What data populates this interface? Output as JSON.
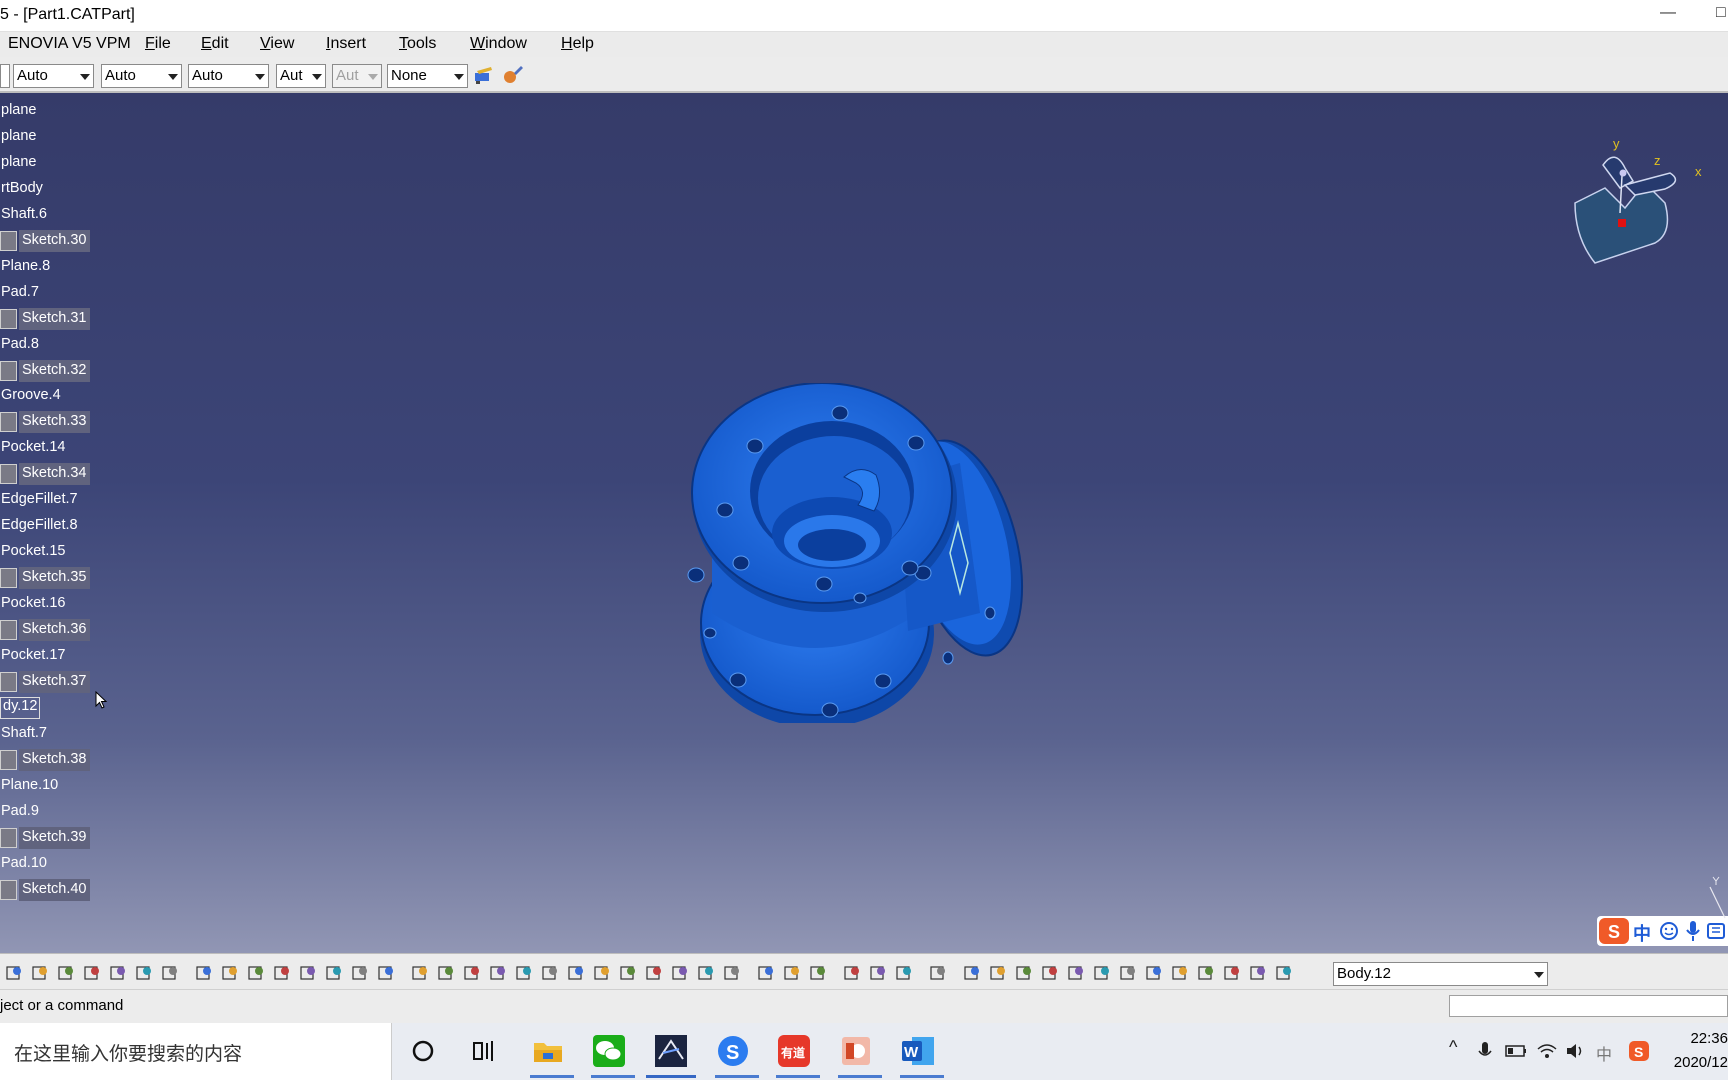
{
  "window": {
    "title": "5 - [Part1.CATPart]",
    "minimize_glyph": "—",
    "restore_glyph": "□"
  },
  "menu": [
    {
      "label": "ENOVIA V5 VPM"
    },
    {
      "label": "File",
      "key": "F",
      "rest": "ile"
    },
    {
      "label": "Edit",
      "key": "E",
      "rest": "dit"
    },
    {
      "label": "View",
      "key": "V",
      "rest": "iew"
    },
    {
      "label": "Insert",
      "key": "I",
      "rest": "nsert"
    },
    {
      "label": "Tools",
      "key": "T",
      "rest": "ools"
    },
    {
      "label": "Window",
      "key": "W",
      "rest": "indow"
    },
    {
      "label": "Help",
      "key": "H",
      "rest": "elp"
    }
  ],
  "properties_toolbar": {
    "combos": [
      {
        "value": "Auto"
      },
      {
        "value": "Auto"
      },
      {
        "value": "Auto"
      },
      {
        "value": "Aut"
      },
      {
        "value": "Aut",
        "disabled": true
      },
      {
        "value": "None"
      }
    ],
    "icons": [
      "painter-icon",
      "apply-material-icon"
    ]
  },
  "tree": {
    "items": [
      {
        "label": "plane",
        "type": "plain"
      },
      {
        "label": "plane",
        "type": "plain"
      },
      {
        "label": "plane",
        "type": "plain"
      },
      {
        "label": "rtBody",
        "type": "plain"
      },
      {
        "label": "Shaft.6",
        "type": "plain"
      },
      {
        "label": "Sketch.30",
        "type": "sketch"
      },
      {
        "label": "Plane.8",
        "type": "plain"
      },
      {
        "label": "Pad.7",
        "type": "plain"
      },
      {
        "label": "Sketch.31",
        "type": "sketch"
      },
      {
        "label": "Pad.8",
        "type": "plain"
      },
      {
        "label": "Sketch.32",
        "type": "sketch"
      },
      {
        "label": "Groove.4",
        "type": "plain"
      },
      {
        "label": "Sketch.33",
        "type": "sketch"
      },
      {
        "label": "Pocket.14",
        "type": "plain"
      },
      {
        "label": "Sketch.34",
        "type": "sketch"
      },
      {
        "label": "EdgeFillet.7",
        "type": "plain"
      },
      {
        "label": "EdgeFillet.8",
        "type": "plain"
      },
      {
        "label": "Pocket.15",
        "type": "plain"
      },
      {
        "label": "Sketch.35",
        "type": "sketch"
      },
      {
        "label": "Pocket.16",
        "type": "plain"
      },
      {
        "label": "Sketch.36",
        "type": "sketch"
      },
      {
        "label": "Pocket.17",
        "type": "plain"
      },
      {
        "label": "Sketch.37",
        "type": "sketch"
      },
      {
        "label": "dy.12",
        "type": "selected"
      },
      {
        "label": "Shaft.7",
        "type": "plain"
      },
      {
        "label": "Sketch.38",
        "type": "sketch"
      },
      {
        "label": "Plane.10",
        "type": "plain"
      },
      {
        "label": "Pad.9",
        "type": "plain"
      },
      {
        "label": "Sketch.39",
        "type": "sketch"
      },
      {
        "label": "Pad.10",
        "type": "plain"
      },
      {
        "label": "Sketch.40",
        "type": "sketch"
      }
    ]
  },
  "compass": {
    "x": "x",
    "y": "y",
    "z": "z"
  },
  "ime_bar": {
    "logo": "S",
    "mode": "中"
  },
  "bottom_toolbar": {
    "current_body": "Body.12",
    "icons": [
      "print-icon",
      "cut-icon",
      "copy-icon",
      "paste-icon",
      "undo-icon",
      "redo-icon",
      "whats-this-icon",
      "formula-icon",
      "comment-icon",
      "sparkle-icon",
      "table-icon",
      "knowledge-icon",
      "lock-icon",
      "hierarchy-icon",
      "fly-icon",
      "fit-all-icon",
      "pan-icon",
      "rotate-icon",
      "zoom-in-icon",
      "zoom-out-icon",
      "normal-view-icon",
      "multi-view-icon",
      "iso-view-icon",
      "shading-icon",
      "hide-show-icon",
      "swap-icon",
      "analysis-icon",
      "snap-icon",
      "cogs-icon",
      "fillet-icon",
      "update-icon",
      "measure-icon",
      "measure-item-icon",
      "inertia-icon",
      "camera-icon",
      "refresh-icon",
      "hand-icon",
      "axis-icon",
      "units-icon",
      "layer-icon",
      "draft-icon",
      "levels-icon",
      "body-icon",
      "sketch-tools-icon",
      "profile-icon",
      "constraint-icon",
      "part-design-icon",
      "workbench-icon"
    ]
  },
  "status": {
    "message": "ject or a command"
  },
  "taskbar": {
    "search_placeholder": "在这里输入你要搜索的内容",
    "apps": [
      "cortana-icon",
      "task-view-icon",
      "file-explorer-icon",
      "wechat-icon",
      "catia-icon",
      "sogou-browser-icon",
      "youdao-icon",
      "powerpoint-icon",
      "word-icon"
    ],
    "youdao_label": "有道",
    "tray": {
      "chevron": "^",
      "ime_label": "中"
    },
    "time": "22:36",
    "date": "2020/12"
  },
  "colors": {
    "part_blue": "#1560d8",
    "part_dark": "#0b3f9e",
    "viewport_top": "#353b69",
    "viewport_bottom": "#9196b4"
  }
}
